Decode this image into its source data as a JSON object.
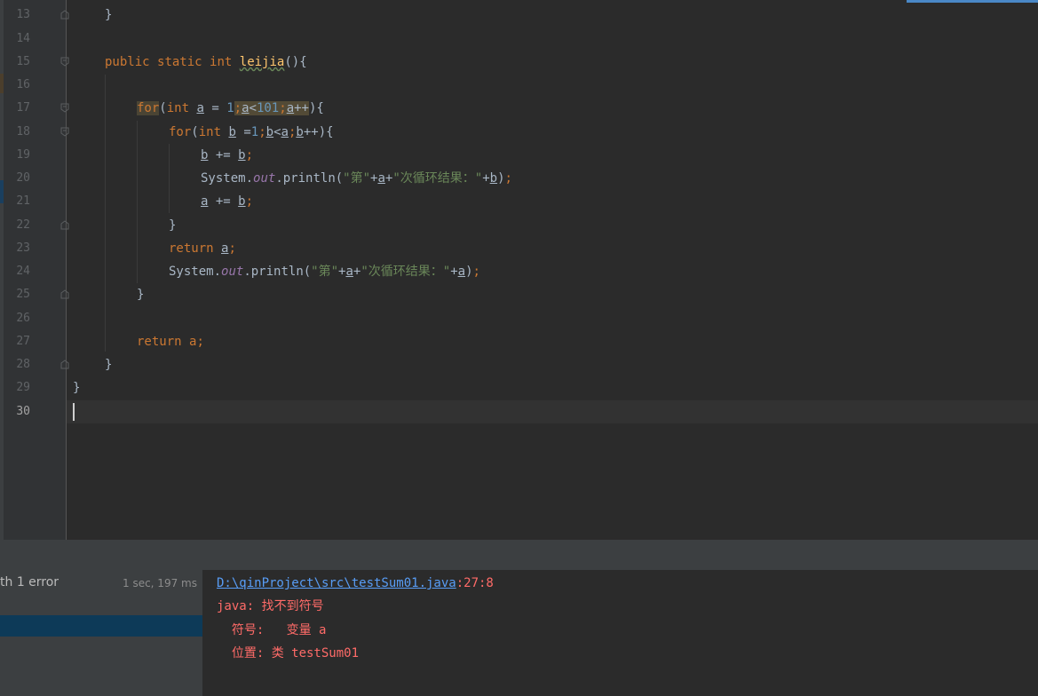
{
  "editor": {
    "line_numbers": [
      "13",
      "14",
      "15",
      "16",
      "17",
      "18",
      "19",
      "20",
      "21",
      "22",
      "23",
      "24",
      "25",
      "26",
      "27",
      "28",
      "29",
      "30"
    ],
    "current_line": "30"
  },
  "code": {
    "l13": {
      "brace": "}"
    },
    "l15": {
      "public": "public",
      "static": "static",
      "int": "int",
      "method": "leijia",
      "tail": "(){"
    },
    "l17": {
      "for": "for",
      "open": "(",
      "int": "int",
      "var_a": "a",
      "assign": " = ",
      "one": "1",
      "semi1": ";",
      "cond_a": "a",
      "lt": "<",
      "n101": "101",
      "semi2": ";",
      "inc_a": "a",
      "inc": "++",
      "close": "){"
    },
    "l18": {
      "for": "for",
      "open": "(",
      "int": "int",
      "var_b": "b",
      "assign": " =",
      "one": "1",
      "semi1": ";",
      "cond_b": "b",
      "lt": "<",
      "cond_a": "a",
      "semi2": ";",
      "inc_b": "b",
      "inc": "++",
      "close": "){"
    },
    "l19": {
      "lhs": "b",
      "op": " += ",
      "rhs": "b",
      "semi": ";"
    },
    "l20": {
      "system": "System.",
      "out": "out",
      "println": ".println(",
      "s1": "\"第\"",
      "plus1": "+",
      "a": "a",
      "plus2": "+",
      "s2": "\"次循环结果：\"",
      "plus3": "+",
      "b": "b",
      "close": ")",
      "semi": ";"
    },
    "l21": {
      "lhs": "a",
      "op": " += ",
      "rhs": "b",
      "semi": ";"
    },
    "l22": {
      "brace": "}"
    },
    "l23": {
      "ret": "return",
      "a": "a",
      "semi": ";"
    },
    "l24": {
      "system": "System.",
      "out": "out",
      "println": ".println(",
      "s1": "\"第\"",
      "plus1": "+",
      "a1": "a",
      "plus2": "+",
      "s2": "\"次循环结果：\"",
      "plus3": "+",
      "a2": "a",
      "close": ")",
      "semi": ";"
    },
    "l25": {
      "brace": "}"
    },
    "l27": {
      "ret": "return",
      "a": "a",
      "semi": ";"
    },
    "l28": {
      "brace": "}"
    },
    "l29": {
      "brace": "}"
    }
  },
  "build": {
    "status": "th 1 error",
    "time": "1 sec, 197 ms"
  },
  "output": {
    "path": "D:\\qinProject\\src\\testSum01.java",
    "position": ":27:8",
    "line2": "java: 找不到符号",
    "line3": "  符号:   变量 a",
    "line4": "  位置: 类 testSum01"
  },
  "colors": {
    "keyword": "#cc7832",
    "number": "#6897bb",
    "string": "#6a8759",
    "field": "#9876aa",
    "method": "#ffc66d",
    "error": "#ff6b68",
    "link": "#589df6"
  }
}
